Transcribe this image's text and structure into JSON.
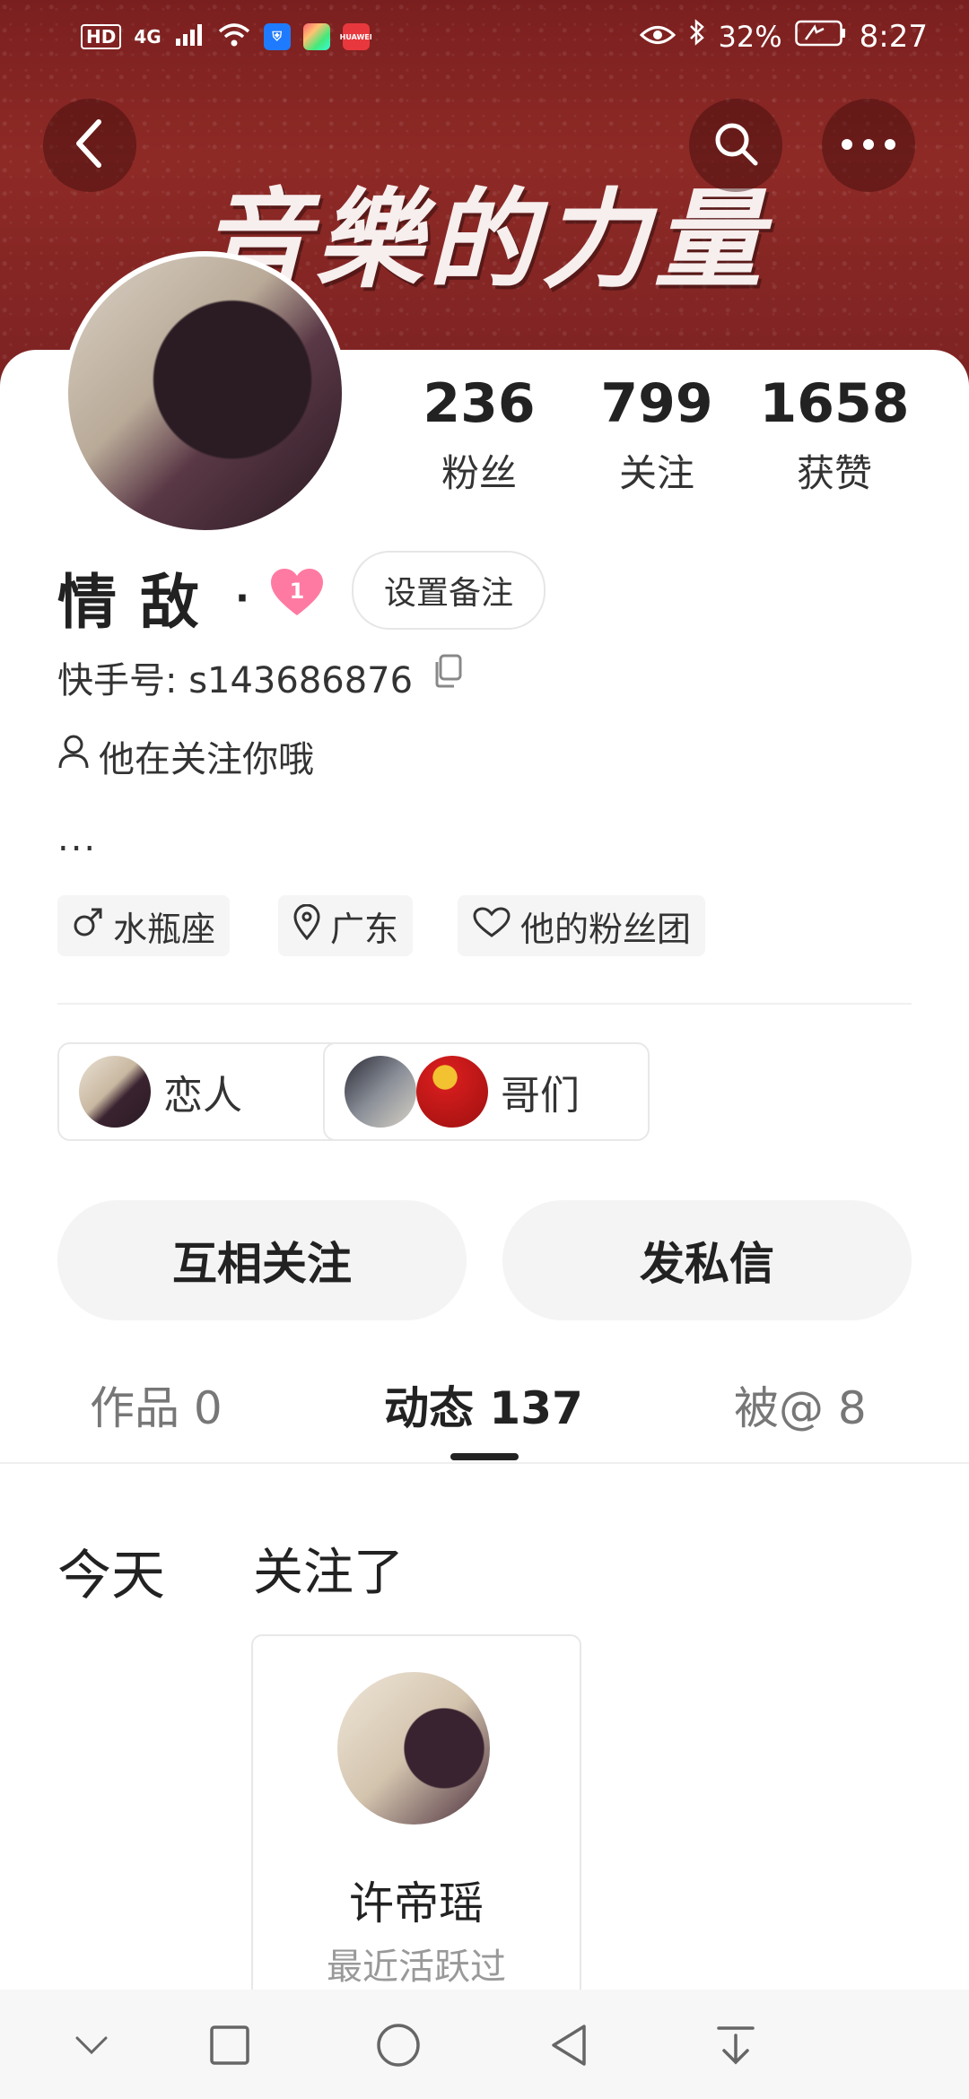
{
  "status_bar": {
    "network_label": "HD",
    "signal_label": "4G",
    "battery_percent": "32%",
    "time": "8:27",
    "app_icons": [
      "shield-app-icon",
      "colorful-app-icon",
      "huawei-app-icon"
    ],
    "huawei_label": "HUAWEI"
  },
  "banner": {
    "title": "音樂的力量"
  },
  "header": {
    "back_icon": "chevron-left-icon",
    "search_icon": "search-icon",
    "more_icon": "more-icon"
  },
  "stats": [
    {
      "value": "236",
      "label": "粉丝"
    },
    {
      "value": "799",
      "label": "关注"
    },
    {
      "value": "1658",
      "label": "获赞"
    }
  ],
  "profile": {
    "name": "情敌",
    "dot": "·",
    "heart_level": "1",
    "remark_button": "设置备注",
    "kuaishou_id": "快手号: s143686876",
    "follow_note": "他在关注你哦",
    "bio_ellipsis": "..."
  },
  "tags": [
    {
      "icon": "male-icon",
      "label": "水瓶座"
    },
    {
      "icon": "location-icon",
      "label": "广东"
    },
    {
      "icon": "heart-outline-icon",
      "label": "他的粉丝团"
    }
  ],
  "relations": [
    {
      "label": "恋人"
    },
    {
      "label": "哥们"
    }
  ],
  "actions": {
    "mutual_follow": "互相关注",
    "message": "发私信"
  },
  "tabs": [
    {
      "label": "作品 0"
    },
    {
      "label": "动态 137"
    },
    {
      "label": "被@ 8"
    }
  ],
  "feed": {
    "date": "今天",
    "action": "关注了",
    "card": {
      "name": "许帝瑶",
      "status": "最近活跃过"
    }
  },
  "navbar": {
    "icons": [
      "chevron-down-icon",
      "square-icon",
      "circle-icon",
      "triangle-back-icon",
      "download-icon"
    ]
  },
  "colors": {
    "banner": "#8e2a26",
    "heart": "#ff6f9a",
    "button_bg": "#f4f4f4"
  }
}
